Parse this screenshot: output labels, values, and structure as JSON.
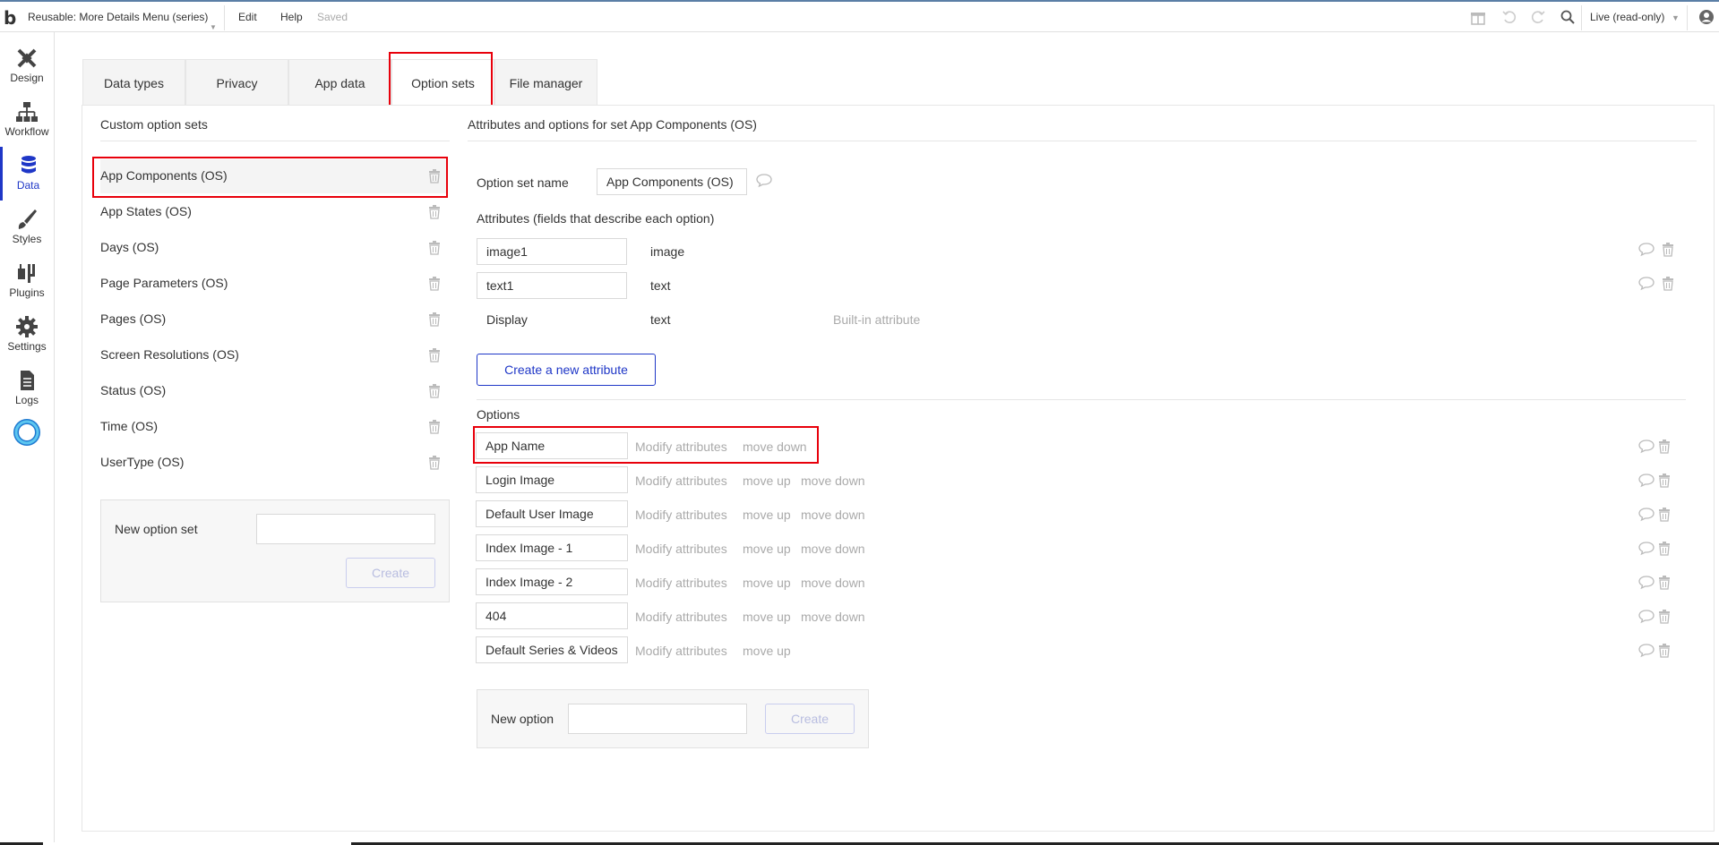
{
  "topbar": {
    "logo": "b",
    "app_title": "Reusable: More Details Menu (series)",
    "menu_edit": "Edit",
    "menu_help": "Help",
    "status": "Saved",
    "mode": "Live (read-only)",
    "icons": [
      "gift-icon",
      "undo-icon",
      "redo-icon",
      "search-icon",
      "user-icon"
    ]
  },
  "sidebar": {
    "items": [
      {
        "label": "Design",
        "icon": "design-icon"
      },
      {
        "label": "Workflow",
        "icon": "workflow-icon"
      },
      {
        "label": "Data",
        "icon": "data-icon",
        "active": true
      },
      {
        "label": "Styles",
        "icon": "styles-icon"
      },
      {
        "label": "Plugins",
        "icon": "plugins-icon"
      },
      {
        "label": "Settings",
        "icon": "settings-icon"
      },
      {
        "label": "Logs",
        "icon": "logs-icon"
      }
    ],
    "accent": "#1f37c7"
  },
  "tabs": [
    {
      "label": "Data types"
    },
    {
      "label": "Privacy"
    },
    {
      "label": "App data"
    },
    {
      "label": "Option sets",
      "active": true
    },
    {
      "label": "File manager"
    }
  ],
  "left": {
    "header": "Custom option sets",
    "sets": [
      "App Components (OS)",
      "App States (OS)",
      "Days (OS)",
      "Page Parameters (OS)",
      "Pages (OS)",
      "Screen Resolutions (OS)",
      "Status (OS)",
      "Time (OS)",
      "UserType (OS)"
    ],
    "new_set_label": "New option set",
    "new_set_value": "",
    "create_label": "Create"
  },
  "right": {
    "header": "Attributes and options for set App Components (OS)",
    "name_label": "Option set name",
    "name_value": "App Components (OS)",
    "attributes_label": "Attributes (fields that describe each option)",
    "attributes": [
      {
        "name": "image1",
        "type": "image"
      },
      {
        "name": "text1",
        "type": "text"
      }
    ],
    "builtin": {
      "name": "Display",
      "type": "text",
      "note": "Built-in attribute"
    },
    "create_attribute_label": "Create a new attribute",
    "options_label": "Options",
    "modify_label": "Modify attributes",
    "move_up_label": "move up",
    "move_down_label": "move down",
    "options": [
      {
        "name": "App Name",
        "up": false,
        "down": true
      },
      {
        "name": "Login Image",
        "up": true,
        "down": true
      },
      {
        "name": "Default User Image",
        "up": true,
        "down": true
      },
      {
        "name": "Index Image - 1",
        "up": true,
        "down": true
      },
      {
        "name": "Index Image - 2",
        "up": true,
        "down": true
      },
      {
        "name": "404",
        "up": true,
        "down": true
      },
      {
        "name": "Default Series & Videos",
        "up": true,
        "down": false
      }
    ],
    "new_option_label": "New option",
    "new_option_value": "",
    "create_label": "Create"
  },
  "colors": {
    "highlight": "#e8000b",
    "brand": "#1f37c7"
  }
}
